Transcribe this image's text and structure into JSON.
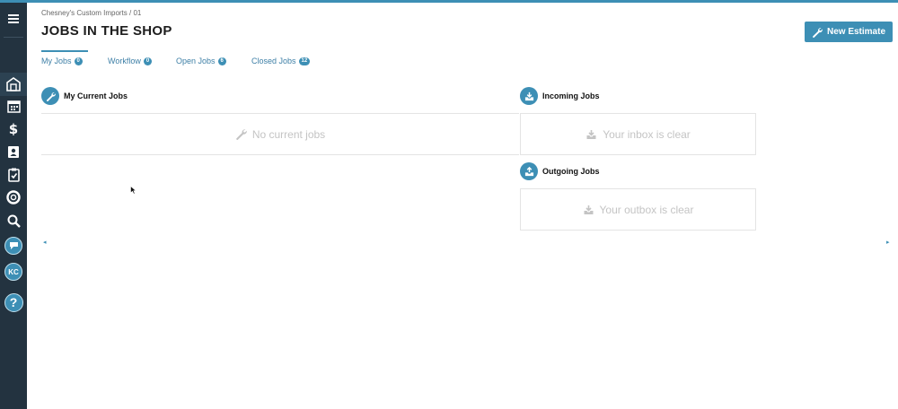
{
  "sidebar": {
    "items": [
      {
        "icon": "menu-icon"
      },
      {
        "icon": "shop-icon"
      },
      {
        "icon": "calendar-icon"
      },
      {
        "icon": "dollar-icon"
      },
      {
        "icon": "contacts-icon"
      },
      {
        "icon": "clipboard-icon"
      },
      {
        "icon": "lifebuoy-icon"
      },
      {
        "icon": "search-icon"
      },
      {
        "icon": "chat-icon"
      },
      {
        "icon": "avatar"
      },
      {
        "icon": "help-icon"
      }
    ],
    "avatar_initials": "KC",
    "help_label": "?"
  },
  "header": {
    "breadcrumb": "Chesney's Custom Imports / 01",
    "title": "JOBS IN THE SHOP",
    "new_button_label": "New Estimate"
  },
  "tabs": [
    {
      "label": "My Jobs",
      "count": "0",
      "active": true
    },
    {
      "label": "Workflow",
      "count": "0",
      "active": false
    },
    {
      "label": "Open Jobs",
      "count": "6",
      "active": false
    },
    {
      "label": "Closed Jobs",
      "count": "12",
      "active": false
    }
  ],
  "panels": {
    "current": {
      "title": "My Current Jobs",
      "empty_text": "No current jobs"
    },
    "incoming": {
      "title": "Incoming Jobs",
      "empty_text": "Your inbox is clear"
    },
    "outgoing": {
      "title": "Outgoing Jobs",
      "empty_text": "Your outbox is clear"
    }
  },
  "scroll": {
    "left": "◂",
    "right": "▸"
  },
  "colors": {
    "accent": "#3d8fb5",
    "sidebar": "#233340",
    "muted_text": "#c4c4c4"
  }
}
